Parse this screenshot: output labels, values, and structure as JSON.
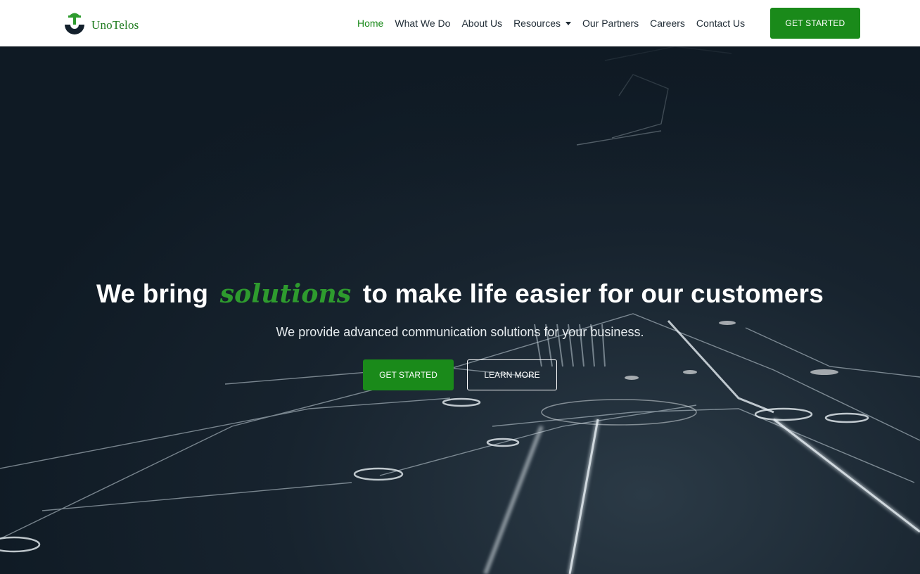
{
  "header": {
    "logo_text": "UnoTelos",
    "nav": [
      {
        "label": "Home",
        "active": true
      },
      {
        "label": "What We Do"
      },
      {
        "label": "About Us"
      },
      {
        "label": "Resources",
        "dropdown": true
      },
      {
        "label": "Our Partners"
      },
      {
        "label": "Careers"
      },
      {
        "label": "Contact Us"
      }
    ],
    "cta_label": "GET STARTED"
  },
  "hero": {
    "title_before": "We bring",
    "title_accent": "solutions",
    "title_after": "to make life easier for our customers",
    "subtitle": "We provide advanced communication solutions for your business.",
    "primary_button": "GET STARTED",
    "secondary_button": "LEARN MORE"
  },
  "colors": {
    "brand_green": "#1a8a1a",
    "accent_green": "#2e9b2e",
    "hero_bg": "#0f1a24",
    "nav_text": "#1f2b35"
  },
  "icons": {
    "logo": "unotelos-logo-icon",
    "resources_dropdown": "caret-down-icon"
  }
}
